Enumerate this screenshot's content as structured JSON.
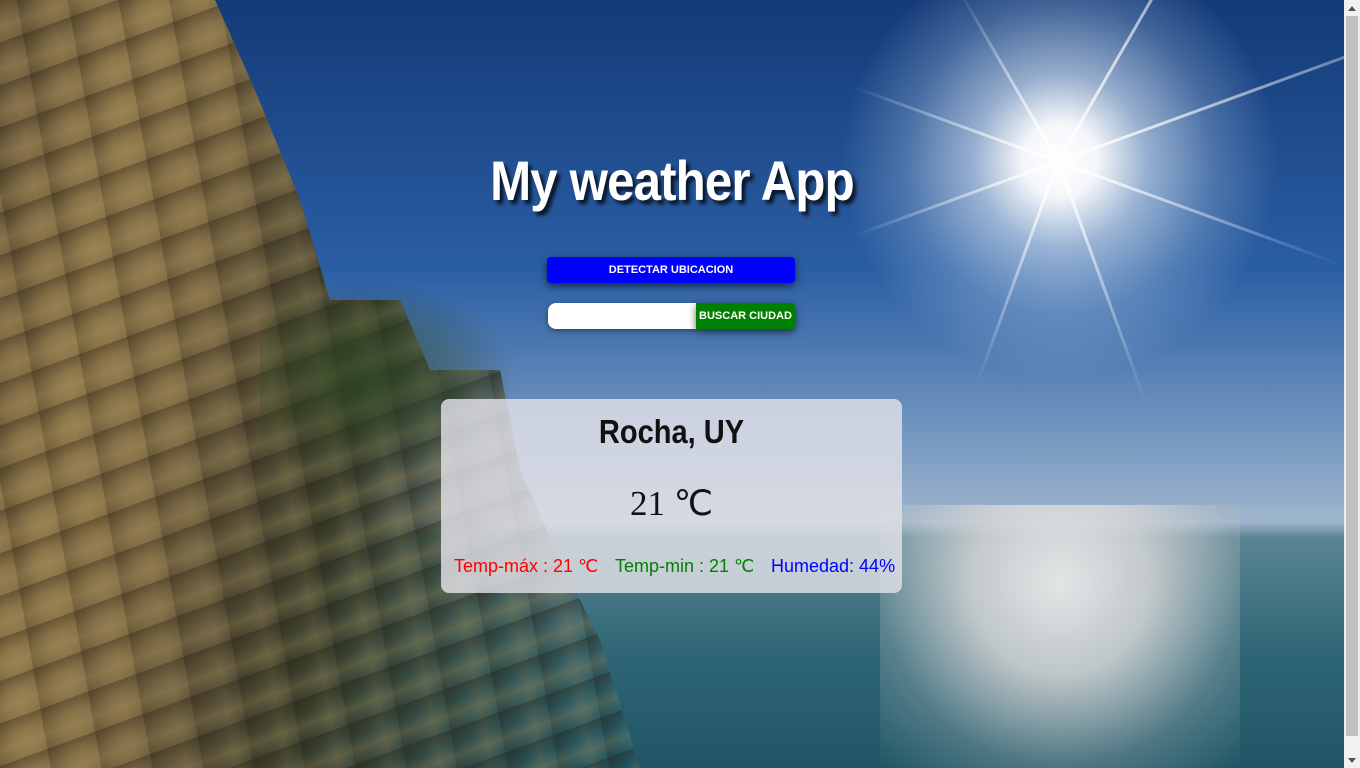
{
  "header": {
    "title": "My weather App"
  },
  "controls": {
    "detect_label": "DETECTAR UBICACION",
    "search_value": "",
    "search_label": "BUSCAR CIUDAD"
  },
  "weather_card": {
    "city": "Rocha, UY",
    "temperature": "21 ℃",
    "temp_max": "Temp-máx : 21 ℃",
    "temp_min": "Temp-min : 21 ℃",
    "humidity": "Humedad: 44%"
  },
  "colors": {
    "detect_button": "#0000ff",
    "search_button": "#008000",
    "temp_max_text": "#ff0000",
    "temp_min_text": "#008000",
    "humidity_text": "#0000ff"
  },
  "background": {
    "scene": "sea-cliff-with-sun"
  }
}
